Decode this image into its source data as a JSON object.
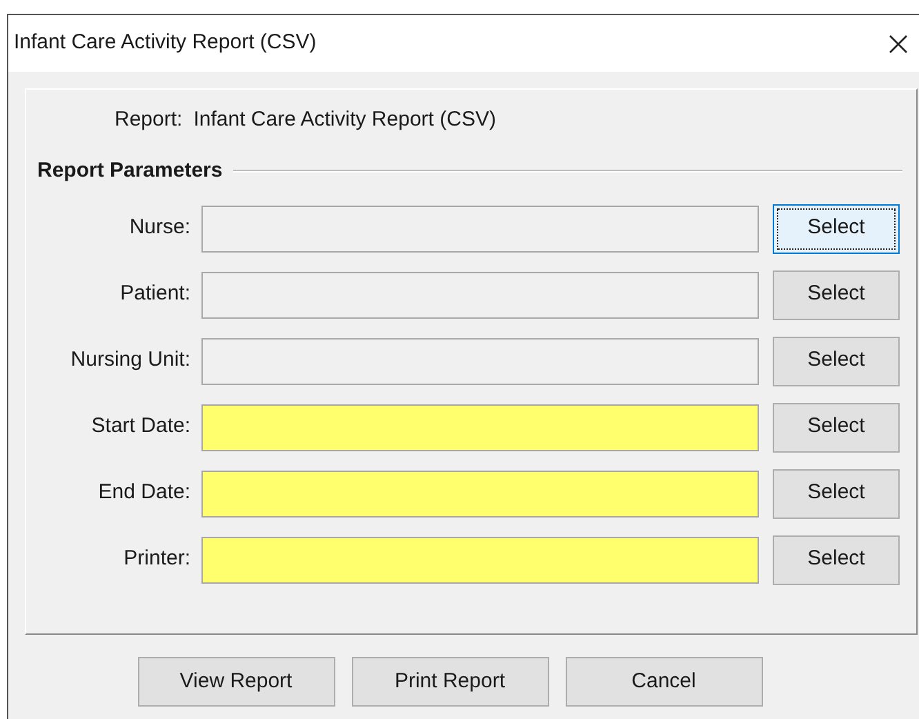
{
  "window": {
    "title": "Infant Care Activity Report (CSV)"
  },
  "report": {
    "label": "Report:",
    "value": "Infant Care Activity Report (CSV)"
  },
  "section": {
    "title": "Report Parameters"
  },
  "parameters": [
    {
      "label": "Nurse:",
      "required": false,
      "button": "Select",
      "focused": true
    },
    {
      "label": "Patient:",
      "required": false,
      "button": "Select",
      "focused": false
    },
    {
      "label": "Nursing Unit:",
      "required": false,
      "button": "Select",
      "focused": false
    },
    {
      "label": "Start Date:",
      "required": true,
      "button": "Select",
      "focused": false
    },
    {
      "label": "End Date:",
      "required": true,
      "button": "Select",
      "focused": false
    },
    {
      "label": "Printer:",
      "required": true,
      "button": "Select",
      "focused": false
    }
  ],
  "buttons": [
    "View Report",
    "Print Report",
    "Cancel"
  ]
}
